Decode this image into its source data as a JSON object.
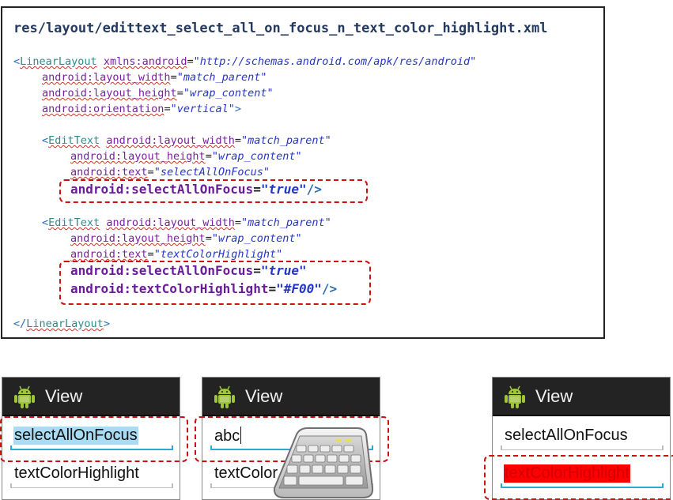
{
  "code_panel": {
    "file_title": "res/layout/edittext_select_all_on_focus_n_text_color_highlight.xml",
    "lines": {
      "l1": {
        "lt": "<",
        "tag": "LinearLayout",
        "attr": "xmlns:android",
        "eq": "=",
        "val": "\"http://schemas.android.com/apk/res/android\""
      },
      "l2": {
        "attr": "android:layout_width",
        "eq": "=",
        "val": "\"match_parent\""
      },
      "l3": {
        "attr": "android:layout_height",
        "eq": "=",
        "val": "\"wrap_content\""
      },
      "l4": {
        "attr": "android:orientation",
        "eq": "=",
        "val": "\"vertical\"",
        "end": ">"
      },
      "l5": {
        "lt": "<",
        "tag": "EditText",
        "attr": "android:layout_width",
        "eq": "=",
        "val": "\"match_parent\""
      },
      "l6": {
        "attr": "android:layout_height",
        "eq": "=",
        "val": "\"wrap_content\""
      },
      "l7": {
        "attr": "android:text",
        "eq": "=",
        "val": "\"selectAllOnFocus\""
      },
      "l8": {
        "attr": "android:selectAllOnFocus",
        "eq": "=",
        "val": "\"true\"",
        "end": "/>"
      },
      "l9": {
        "lt": "<",
        "tag": "EditText",
        "attr": "android:layout_width",
        "eq": "=",
        "val": "\"match_parent\""
      },
      "l10": {
        "attr": "android:layout_height",
        "eq": "=",
        "val": "\"wrap_content\""
      },
      "l11": {
        "attr": "android:text",
        "eq": "=",
        "val": "\"textColorHighlight\""
      },
      "l12": {
        "attr": "android:selectAllOnFocus",
        "eq": "=",
        "val": "\"true\""
      },
      "l13": {
        "attr": "android:textColorHighlight",
        "eq": "=",
        "val": "\"#F00\"",
        "end": "/>"
      },
      "l14": {
        "lt": "</",
        "tag": "LinearLayout",
        "end": ">"
      }
    }
  },
  "phones": [
    {
      "title": "View",
      "field1": "selectAllOnFocus",
      "field2": "textColorHighlight"
    },
    {
      "title": "View",
      "field1": "abc",
      "field2": "textColor"
    },
    {
      "title": "View",
      "field1": "selectAllOnFocus",
      "field2": "textColorHighlight"
    }
  ],
  "colors": {
    "highlight_blue": "#a9dcf2",
    "highlight_red": "#ff0000",
    "focus_line": "#2ea8d6",
    "action_bar": "#232323",
    "dash_red": "#cc1111",
    "android_green": "#9fc63b"
  },
  "icons": {
    "app_icon": "android-robot-icon",
    "keyboard": "keyboard-icon"
  }
}
